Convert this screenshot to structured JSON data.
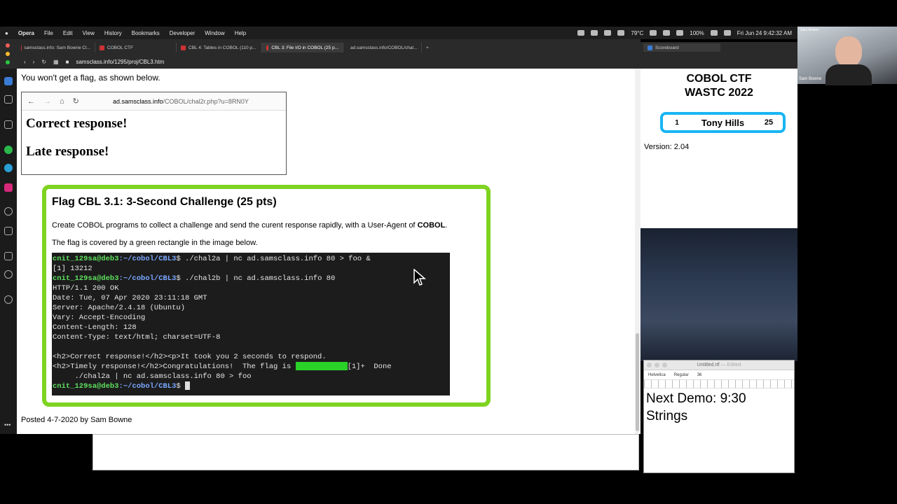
{
  "menubar": {
    "apple": "",
    "app": "Opera",
    "items": [
      "File",
      "Edit",
      "View",
      "History",
      "Bookmarks",
      "Developer",
      "Window",
      "Help"
    ],
    "temperature": "79°C",
    "battery": "100%",
    "datetime": "Fri Jun 24  9:42:32 AM"
  },
  "browser": {
    "tabs": [
      {
        "label": "samsclass.info: Sam Bowne Cl..."
      },
      {
        "label": "COBOL CTF"
      },
      {
        "label": "CBL 4: Tables in COBOL (110 p..."
      },
      {
        "label": "CBL 3: File I/O in COBOL (25 p..."
      },
      {
        "label": "ad.samsclass.info/COBOL/chal..."
      }
    ],
    "url": "samsclass.info/1295/proj/CBL3.htm"
  },
  "page": {
    "intro": "You won't get a flag, as shown below.",
    "screenshot": {
      "url_prefix": "ad.samsclass.info",
      "url_rest": "/COBOL/chal2r.php?u=8RN0Y",
      "line1": "Correct response!",
      "line2": "Late response!"
    },
    "flag": {
      "title": "Flag CBL 3.1: 3-Second Challenge (25 pts)",
      "p1_pre": "Create COBOL programs to collect a challenge and send the curent response rapidly, with a User-Agent of ",
      "p1_bold": "COBOL",
      "p1_post": ".",
      "p2": "The flag is covered by a green rectangle in the image below."
    },
    "terminal": {
      "prompt_user": "cnit_129sa@deb3",
      "prompt_path": ":~/cobol/CBL3",
      "cmd1": "$ ./chal2a | nc ad.samsclass.info 80 > foo &",
      "job": "[1] 13212",
      "cmd2": "$ ./chal2b | nc ad.samsclass.info 80",
      "lines": [
        "HTTP/1.1 200 OK",
        "Date: Tue, 07 Apr 2020 23:11:18 GMT",
        "Server: Apache/2.4.18 (Ubuntu)",
        "Vary: Accept-Encoding",
        "Content-Length: 128",
        "Content-Type: text/html; charset=UTF-8",
        "",
        "<h2>Correct response!</h2><p>It took you 2 seconds to respond."
      ],
      "flag_line_pre": "<h2>Timely response!</h2>Congratulations!  The flag is ",
      "flag_line_post": "[1]+  Done",
      "done_line": "     ./chal2a | nc ad.samsclass.info 80 > foo",
      "end_prompt": "$ "
    },
    "posted": "Posted 4-7-2020 by Sam Bowne"
  },
  "scoreboard": {
    "tab": "Scoreboard",
    "title1": "COBOL CTF",
    "title2": "WASTC 2022",
    "rank": "1",
    "name": "Tony Hills",
    "points": "25",
    "version": "Version: 2.04"
  },
  "webcam": {
    "label": "Sam Bowne",
    "caption": "Sam Bowne"
  },
  "textedit": {
    "title": "Untitled.rtf",
    "edited": "— Edited",
    "font": "Helvetica",
    "style": "Regular",
    "size": "36",
    "line1": "Next Demo:  9:30",
    "line2": "Strings"
  },
  "colors": {
    "flag_border": "#7ed321",
    "score_border": "#19b5f2"
  }
}
